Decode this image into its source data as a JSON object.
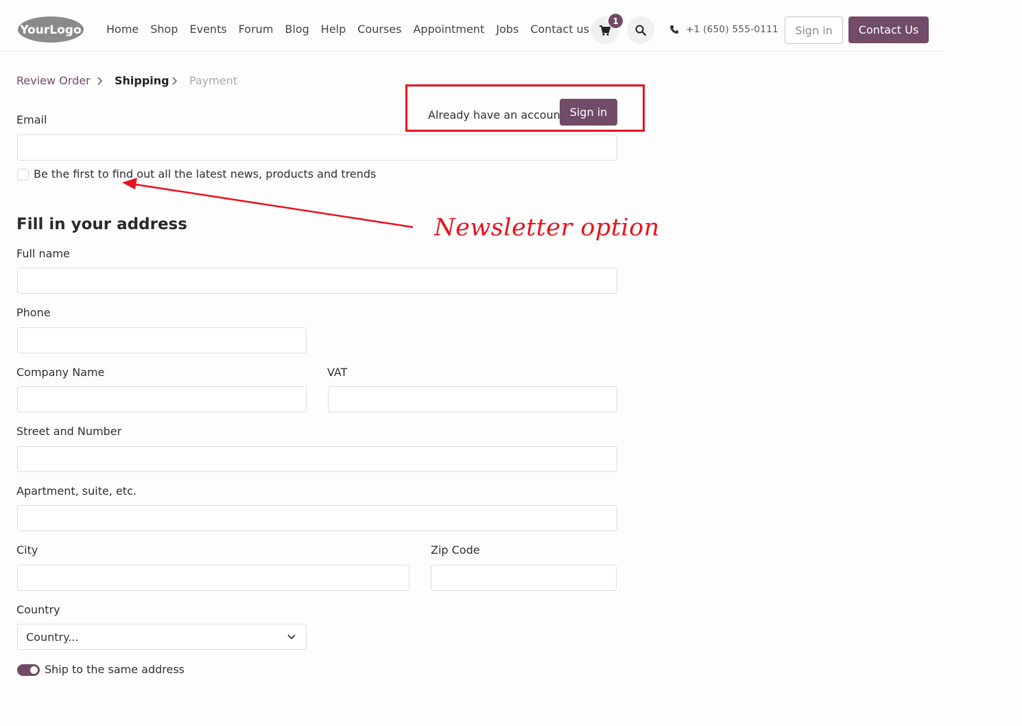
{
  "header": {
    "logo_text": "YourLogo",
    "nav": [
      "Home",
      "Shop",
      "Events",
      "Forum",
      "Blog",
      "Help",
      "Courses",
      "Appointment",
      "Jobs",
      "Contact us"
    ],
    "cart_count": "1",
    "phone": "+1 (650) 555-0111",
    "sign_in": "Sign in",
    "contact_us": "Contact Us"
  },
  "breadcrumb": {
    "step1": "Review Order",
    "step2": "Shipping",
    "step3": "Payment"
  },
  "account": {
    "prompt": "Already have an account?",
    "sign_in": "Sign in"
  },
  "form": {
    "email_label": "Email",
    "newsletter_label": "Be the first to find out all the latest news, products and trends",
    "newsletter_checked": false,
    "address_heading": "Fill in your address",
    "full_name_label": "Full name",
    "phone_label": "Phone",
    "company_label": "Company Name",
    "vat_label": "VAT",
    "street_label": "Street and Number",
    "apartment_label": "Apartment, suite, etc.",
    "city_label": "City",
    "zip_label": "Zip Code",
    "country_label": "Country",
    "country_value": "Country...",
    "ship_same_label": "Ship to the same address",
    "ship_same_on": true
  },
  "annotation": {
    "text": "Newsletter option",
    "color": "#e8121e"
  },
  "colors": {
    "brand": "#714b67",
    "annotation": "#e8121e"
  },
  "icons": [
    "cart-icon",
    "search-icon",
    "phone-icon",
    "chevron-right-icon",
    "chevron-down-icon"
  ]
}
